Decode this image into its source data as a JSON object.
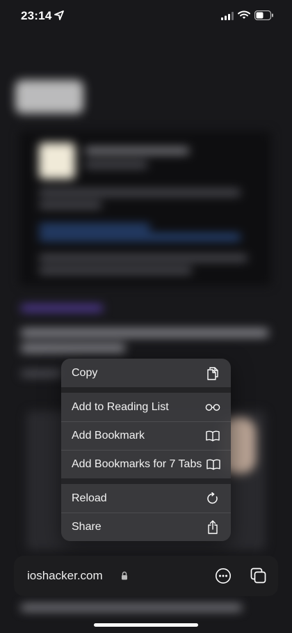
{
  "status_bar": {
    "time": "23:14",
    "icons": [
      "location-arrow-icon",
      "signal-icon",
      "wifi-icon",
      "battery-icon"
    ]
  },
  "context_menu": {
    "groups": [
      [
        {
          "label": "Copy",
          "icon": "copy-document-icon"
        }
      ],
      [
        {
          "label": "Add to Reading List",
          "icon": "glasses-icon"
        },
        {
          "label": "Add Bookmark",
          "icon": "book-icon"
        },
        {
          "label": "Add Bookmarks for 7 Tabs",
          "icon": "book-icon"
        }
      ],
      [
        {
          "label": "Reload",
          "icon": "reload-icon"
        },
        {
          "label": "Share",
          "icon": "share-icon"
        }
      ]
    ]
  },
  "address_bar": {
    "url": "ioshacker.com",
    "icons": [
      "lock-icon",
      "more-options-icon",
      "tabs-icon"
    ]
  },
  "colors": {
    "background": "#18181b",
    "menu": "#3a3a3e",
    "address_bar": "#1d1d1f",
    "text": "#ffffff"
  }
}
